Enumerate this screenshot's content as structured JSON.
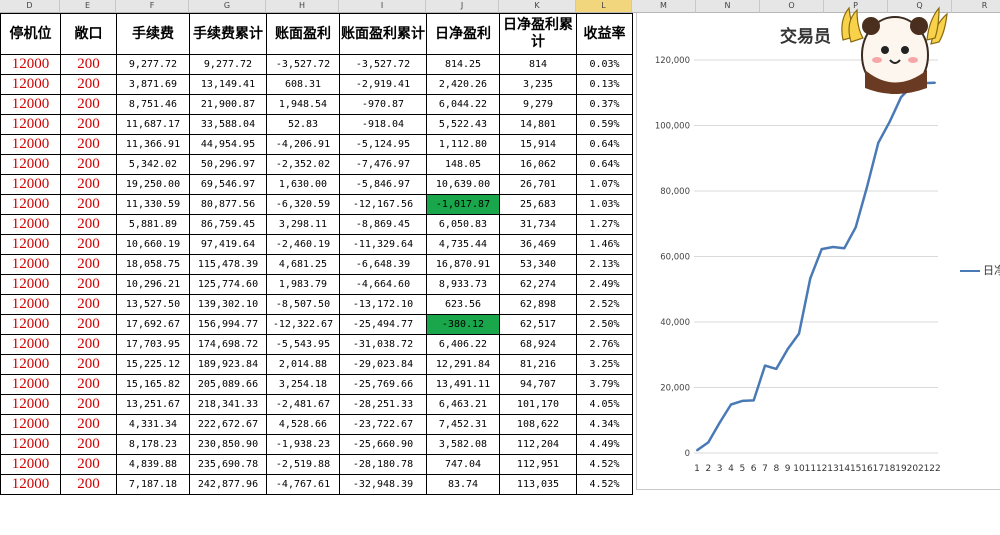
{
  "column_letters": [
    "D",
    "E",
    "F",
    "G",
    "H",
    "I",
    "J",
    "K",
    "L",
    "M",
    "N",
    "O",
    "P",
    "Q",
    "R"
  ],
  "selected_column": "L",
  "headers": [
    "停机位",
    "敞口",
    "手续费",
    "手续费累计",
    "账面盈利",
    "账面盈利累计",
    "日净盈利",
    "日净盈利累计",
    "收益率"
  ],
  "rows": [
    [
      "12000",
      "200",
      "9,277.72",
      "9,277.72",
      "-3,527.72",
      "-3,527.72",
      "814.25",
      "814",
      "0.03%"
    ],
    [
      "12000",
      "200",
      "3,871.69",
      "13,149.41",
      "608.31",
      "-2,919.41",
      "2,420.26",
      "3,235",
      "0.13%"
    ],
    [
      "12000",
      "200",
      "8,751.46",
      "21,900.87",
      "1,948.54",
      "-970.87",
      "6,044.22",
      "9,279",
      "0.37%"
    ],
    [
      "12000",
      "200",
      "11,687.17",
      "33,588.04",
      "52.83",
      "-918.04",
      "5,522.43",
      "14,801",
      "0.59%"
    ],
    [
      "12000",
      "200",
      "11,366.91",
      "44,954.95",
      "-4,206.91",
      "-5,124.95",
      "1,112.80",
      "15,914",
      "0.64%"
    ],
    [
      "12000",
      "200",
      "5,342.02",
      "50,296.97",
      "-2,352.02",
      "-7,476.97",
      "148.05",
      "16,062",
      "0.64%"
    ],
    [
      "12000",
      "200",
      "19,250.00",
      "69,546.97",
      "1,630.00",
      "-5,846.97",
      "10,639.00",
      "26,701",
      "1.07%"
    ],
    [
      "12000",
      "200",
      "11,330.59",
      "80,877.56",
      "-6,320.59",
      "-12,167.56",
      "-1,017.87",
      "25,683",
      "1.03%"
    ],
    [
      "12000",
      "200",
      "5,881.89",
      "86,759.45",
      "3,298.11",
      "-8,869.45",
      "6,050.83",
      "31,734",
      "1.27%"
    ],
    [
      "12000",
      "200",
      "10,660.19",
      "97,419.64",
      "-2,460.19",
      "-11,329.64",
      "4,735.44",
      "36,469",
      "1.46%"
    ],
    [
      "12000",
      "200",
      "18,058.75",
      "115,478.39",
      "4,681.25",
      "-6,648.39",
      "16,870.91",
      "53,340",
      "2.13%"
    ],
    [
      "12000",
      "200",
      "10,296.21",
      "125,774.60",
      "1,983.79",
      "-4,664.60",
      "8,933.73",
      "62,274",
      "2.49%"
    ],
    [
      "12000",
      "200",
      "13,527.50",
      "139,302.10",
      "-8,507.50",
      "-13,172.10",
      "623.56",
      "62,898",
      "2.52%"
    ],
    [
      "12000",
      "200",
      "17,692.67",
      "156,994.77",
      "-12,322.67",
      "-25,494.77",
      "-380.12",
      "62,517",
      "2.50%"
    ],
    [
      "12000",
      "200",
      "17,703.95",
      "174,698.72",
      "-5,543.95",
      "-31,038.72",
      "6,406.22",
      "68,924",
      "2.76%"
    ],
    [
      "12000",
      "200",
      "15,225.12",
      "189,923.84",
      "2,014.88",
      "-29,023.84",
      "12,291.84",
      "81,216",
      "3.25%"
    ],
    [
      "12000",
      "200",
      "15,165.82",
      "205,089.66",
      "3,254.18",
      "-25,769.66",
      "13,491.11",
      "94,707",
      "3.79%"
    ],
    [
      "12000",
      "200",
      "13,251.67",
      "218,341.33",
      "-2,481.67",
      "-28,251.33",
      "6,463.21",
      "101,170",
      "4.05%"
    ],
    [
      "12000",
      "200",
      "4,331.34",
      "222,672.67",
      "4,528.66",
      "-23,722.67",
      "7,452.31",
      "108,622",
      "4.34%"
    ],
    [
      "12000",
      "200",
      "8,178.23",
      "230,850.90",
      "-1,938.23",
      "-25,660.90",
      "3,582.08",
      "112,204",
      "4.49%"
    ],
    [
      "12000",
      "200",
      "4,839.88",
      "235,690.78",
      "-2,519.88",
      "-28,180.78",
      "747.04",
      "112,951",
      "4.52%"
    ],
    [
      "12000",
      "200",
      "7,187.18",
      "242,877.96",
      "-4,767.61",
      "-32,948.39",
      "83.74",
      "113,035",
      "4.52%"
    ]
  ],
  "highlight_color": "#1aa64a",
  "chart_data": {
    "type": "line",
    "title": "交易员",
    "x": [
      1,
      2,
      3,
      4,
      5,
      6,
      7,
      8,
      9,
      10,
      11,
      12,
      13,
      14,
      15,
      16,
      17,
      18,
      19,
      20,
      21,
      22
    ],
    "series": [
      {
        "name": "日净",
        "values": [
          814,
          3235,
          9279,
          14801,
          15914,
          16062,
          26701,
          25683,
          31734,
          36469,
          53340,
          62274,
          62898,
          62517,
          68924,
          81216,
          94707,
          101170,
          108622,
          112204,
          112951,
          113035
        ]
      }
    ],
    "ylim": [
      0,
      120000
    ],
    "yticks": [
      "0",
      "20,000",
      "40,000",
      "60,000",
      "80,000",
      "100,000",
      "120,000"
    ],
    "ytick_values": [
      0,
      20000,
      40000,
      60000,
      80000,
      100000,
      120000
    ],
    "grid": true,
    "legend": "right",
    "line_color": "#4a7ab5"
  }
}
